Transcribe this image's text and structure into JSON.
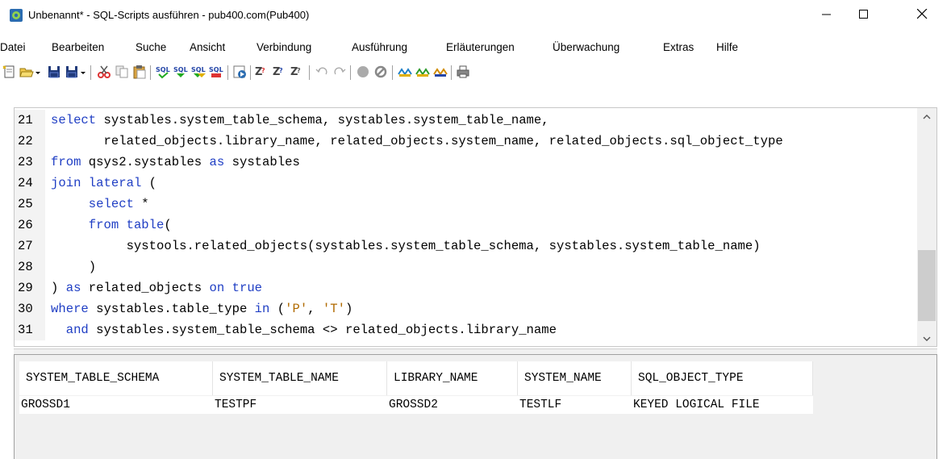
{
  "window": {
    "title": "Unbenannt* - SQL-Scripts ausführen - pub400.com(Pub400)",
    "app_icon": "sql-scripts-app-icon",
    "controls": [
      "minimize-icon",
      "maximize-icon",
      "close-icon"
    ]
  },
  "menu": [
    "Datei",
    "Bearbeiten",
    "Suche",
    "Ansicht",
    "Verbindung",
    "Ausführung",
    "Erläuterungen",
    "Überwachung",
    "Extras",
    "Hilfe"
  ],
  "toolbar": {
    "icons": [
      "new-file-icon",
      "open-file-icon",
      "save-icon",
      "save-as-icon",
      "cut-icon",
      "copy-icon",
      "paste-icon",
      "sql-check-icon",
      "sql-run-icon",
      "sql-run-all-icon",
      "sql-run-selected-icon",
      "run-script-icon",
      "explain-icon",
      "explain-visual-icon",
      "explain-stop-icon",
      "undo-icon",
      "redo-icon",
      "stop-icon",
      "cancel-icon",
      "monitor-icon",
      "monitor-green-icon",
      "monitor-yellow-icon",
      "print-icon"
    ]
  },
  "editor": {
    "lines": [
      {
        "num": "21",
        "code": "select systables.system_table_schema, systables.system_table_name,"
      },
      {
        "num": "22",
        "code": "       related_objects.library_name, related_objects.system_name, related_objects.sql_object_type"
      },
      {
        "num": "23",
        "code": "from qsys2.systables as systables"
      },
      {
        "num": "24",
        "code": "join lateral ("
      },
      {
        "num": "25",
        "code": "     select *"
      },
      {
        "num": "26",
        "code": "     from table("
      },
      {
        "num": "27",
        "code": "          systools.related_objects(systables.system_table_schema, systables.system_table_name)"
      },
      {
        "num": "28",
        "code": "     )"
      },
      {
        "num": "29",
        "code": ") as related_objects on true"
      },
      {
        "num": "30",
        "code": "where systables.table_type in ('P', 'T')"
      },
      {
        "num": "31",
        "code": "  and systables.system_table_schema <> related_objects.library_name"
      }
    ],
    "scrollbar": {
      "up": "chevron-up-icon",
      "down": "chevron-down-icon"
    }
  },
  "results": {
    "columns": [
      "SYSTEM_TABLE_SCHEMA",
      "SYSTEM_TABLE_NAME",
      "LIBRARY_NAME",
      "SYSTEM_NAME",
      "SQL_OBJECT_TYPE"
    ],
    "rows": [
      [
        "GROSSD1",
        "TESTPF",
        "GROSSD2",
        "TESTLF",
        "KEYED LOGICAL FILE"
      ]
    ]
  },
  "colors": {
    "keyword": "#1f3ec4",
    "string": "#b06a00",
    "gutter": "#f3f3f3",
    "panel": "#f0f0f0"
  }
}
